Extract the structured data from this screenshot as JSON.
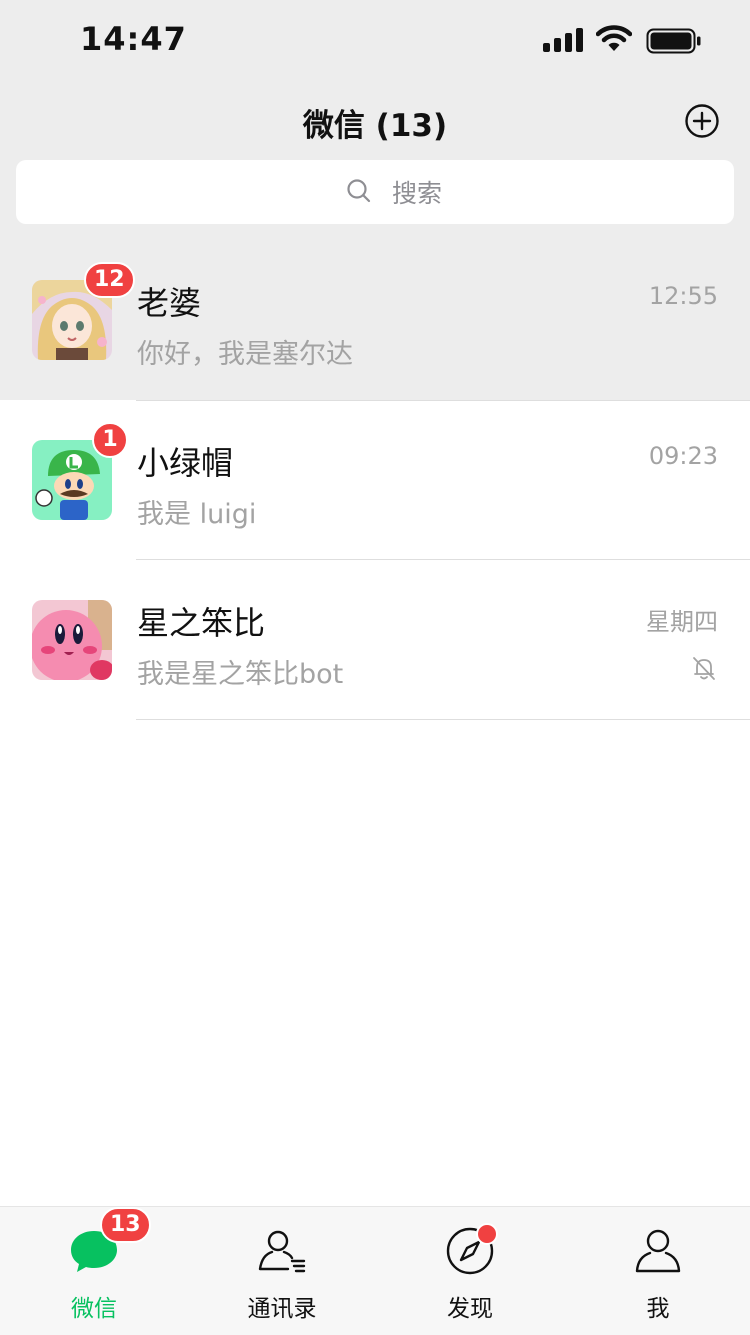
{
  "status_bar": {
    "time": "14:47"
  },
  "header": {
    "title": "微信 (13)"
  },
  "search": {
    "placeholder": "搜索"
  },
  "chats": [
    {
      "name": "老婆",
      "message": "你好，我是塞尔达",
      "time": "12:55",
      "unread": "12",
      "pinned": true,
      "muted": false
    },
    {
      "name": "小绿帽",
      "message": "我是 luigi",
      "time": "09:23",
      "unread": "1",
      "pinned": false,
      "muted": false
    },
    {
      "name": "星之笨比",
      "message": "我是星之笨比bot",
      "time": "星期四",
      "unread": "",
      "pinned": false,
      "muted": true
    }
  ],
  "tabbar": {
    "tabs": [
      {
        "label": "微信",
        "badge": "13",
        "active": true,
        "icon": "chat-bubble-icon"
      },
      {
        "label": "通讯录",
        "active": false,
        "icon": "contacts-icon"
      },
      {
        "label": "发现",
        "active": false,
        "icon": "compass-icon",
        "dot": true
      },
      {
        "label": "我",
        "active": false,
        "icon": "person-icon"
      }
    ]
  },
  "colors": {
    "accent": "#07c160",
    "badge": "#f04141",
    "header_bg": "#ededed",
    "muted_text": "#a3a3a3"
  }
}
